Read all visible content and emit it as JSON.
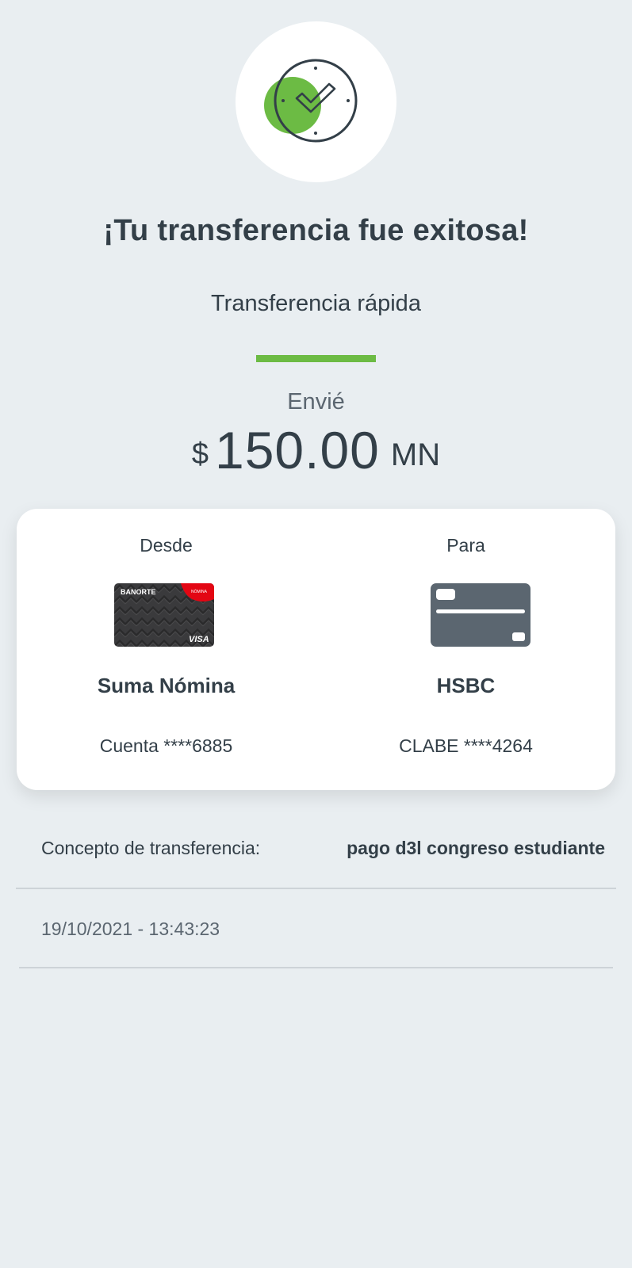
{
  "status": {
    "icon": "clock-check-icon",
    "title": "¡Tu transferencia fue exitosa!"
  },
  "transfer": {
    "type": "Transferencia rápida",
    "sent_label": "Envié",
    "currency_symbol": "$",
    "amount": "150.00",
    "currency_code": "MN"
  },
  "accounts": {
    "from": {
      "heading": "Desde",
      "card_brand": "BANORTE",
      "card_tag": "NÓMINA",
      "card_network": "VISA",
      "name": "Suma Nómina",
      "number": "Cuenta ****6885"
    },
    "to": {
      "heading": "Para",
      "icon": "generic-card-icon",
      "name": "HSBC",
      "number": "CLABE ****4264"
    }
  },
  "details": {
    "concept_label": "Concepto de transferencia:",
    "concept_value": "pago d3l congreso estudiante",
    "datetime": "19/10/2021 - 13:43:23"
  },
  "colors": {
    "background": "#e9eef1",
    "accent_green": "#6cbb44",
    "text_dark": "#333f48",
    "card_gray": "#5b6670",
    "banorte_red": "#e30613"
  }
}
